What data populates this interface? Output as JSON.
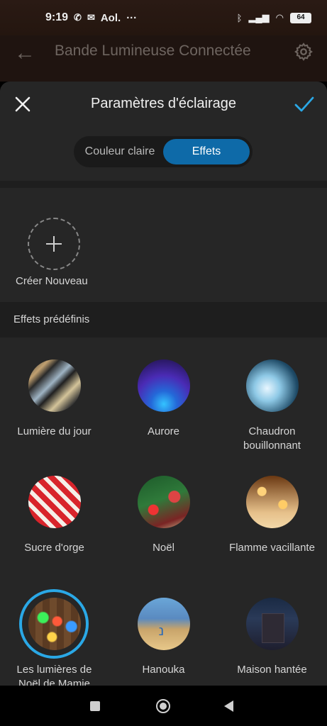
{
  "status_bar": {
    "time": "9:19",
    "notification_text": "Aol.",
    "more": "···",
    "battery": "64",
    "icons": [
      "whatsapp-icon",
      "messenger-icon",
      "bluetooth-icon",
      "signal-icon",
      "wifi-icon",
      "battery-icon"
    ]
  },
  "app_bar": {
    "title": "Bande Lumineuse Connectée",
    "icons": [
      "back-arrow-icon",
      "gear-icon"
    ]
  },
  "sheet": {
    "title": "Paramètres d'éclairage",
    "icons": [
      "close-icon",
      "check-icon"
    ],
    "accent_color": "#2aa8e6",
    "segment": {
      "options": [
        "Couleur claire",
        "Effets"
      ],
      "selected": "Effets",
      "active_color": "#0e6aa8"
    },
    "create_label": "Créer Nouveau",
    "section_title": "Effets prédéfinis",
    "effects": [
      {
        "label": "Lumière du jour"
      },
      {
        "label": "Aurore"
      },
      {
        "label": "Chaudron bouillonnant"
      },
      {
        "label": "Sucre d'orge"
      },
      {
        "label": "Noël"
      },
      {
        "label": "Flamme vacillante"
      },
      {
        "label": "Les lumières de Noël de Mamie",
        "selected": true
      },
      {
        "label": "Hanouka"
      },
      {
        "label": "Maison hantée"
      }
    ]
  },
  "nav_bar": {
    "icons": [
      "recents-square-icon",
      "home-circle-icon",
      "back-triangle-icon"
    ]
  }
}
